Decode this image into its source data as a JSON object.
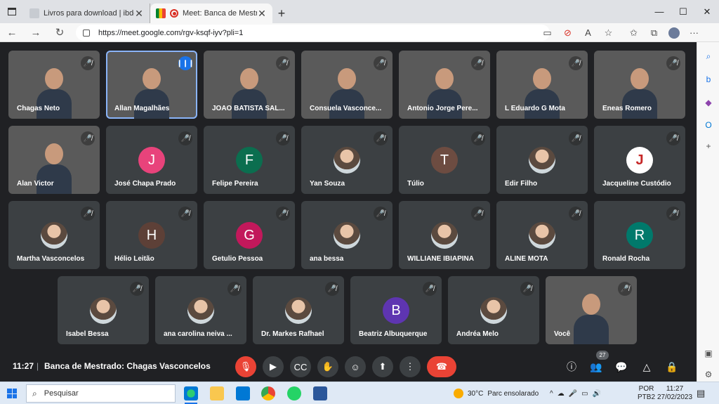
{
  "browser": {
    "tabs": [
      {
        "title": "Livros para download | ibdcult",
        "active": false
      },
      {
        "title": "Meet: Banca de Mestrado: C",
        "active": true
      }
    ],
    "url": "https://meet.google.com/rgv-ksqf-iyv?pli=1"
  },
  "meeting": {
    "time": "11:27",
    "separator": "|",
    "title": "Banca de Mestrado: Chagas Vasconcelos",
    "participant_count": "27"
  },
  "participants": [
    {
      "name": "Chagas Neto",
      "kind": "video",
      "mic": "muted"
    },
    {
      "name": "Allan Magalhães",
      "kind": "video",
      "mic": "speaking"
    },
    {
      "name": "JOAO BATISTA SAL...",
      "kind": "video",
      "mic": "muted"
    },
    {
      "name": "Consuela Vasconce...",
      "kind": "video",
      "mic": "muted"
    },
    {
      "name": "Antonio Jorge Pere...",
      "kind": "video",
      "mic": "muted"
    },
    {
      "name": "L Eduardo G Mota",
      "kind": "video",
      "mic": "muted"
    },
    {
      "name": "Eneas Romero",
      "kind": "video",
      "mic": "muted"
    },
    {
      "name": "Alan Victor",
      "kind": "video",
      "mic": "muted"
    },
    {
      "name": "José Chapa Prado",
      "kind": "letter",
      "letter": "J",
      "color": "#e8437b",
      "mic": "muted"
    },
    {
      "name": "Felipe Pereira",
      "kind": "letter",
      "letter": "F",
      "color": "#0b6e4f",
      "mic": "muted"
    },
    {
      "name": "Yan Souza",
      "kind": "photo",
      "mic": "muted"
    },
    {
      "name": "Túlio",
      "kind": "letter",
      "letter": "T",
      "color": "#6d4c41",
      "mic": "muted"
    },
    {
      "name": "Edir Filho",
      "kind": "photo",
      "mic": "muted"
    },
    {
      "name": "Jacqueline Custódio",
      "kind": "logo",
      "letter": "J",
      "mic": "muted"
    },
    {
      "name": "Martha Vasconcelos",
      "kind": "photo",
      "mic": "muted"
    },
    {
      "name": "Hélio Leitão",
      "kind": "letter",
      "letter": "H",
      "color": "#5d4037",
      "mic": "muted"
    },
    {
      "name": "Getulio Pessoa",
      "kind": "letter",
      "letter": "G",
      "color": "#c2185b",
      "mic": "muted"
    },
    {
      "name": "ana bessa",
      "kind": "photo",
      "mic": "muted"
    },
    {
      "name": "WILLIANE IBIAPINA",
      "kind": "photo",
      "mic": "muted"
    },
    {
      "name": "ALINE MOTA",
      "kind": "photo",
      "mic": "muted"
    },
    {
      "name": "Ronald Rocha",
      "kind": "letter",
      "letter": "R",
      "color": "#00796b",
      "mic": "muted"
    },
    {
      "name": "Isabel Bessa",
      "kind": "photo",
      "mic": "muted"
    },
    {
      "name": "ana carolina neiva ...",
      "kind": "photo",
      "mic": "muted"
    },
    {
      "name": "Dr. Markes Rafhael",
      "kind": "photo",
      "mic": "muted"
    },
    {
      "name": "Beatriz Albuquerque",
      "kind": "letter",
      "letter": "B",
      "color": "#5e35b1",
      "mic": "muted"
    },
    {
      "name": "Andréa Melo",
      "kind": "photo",
      "mic": "muted"
    },
    {
      "name": "Você",
      "kind": "video",
      "mic": "muted"
    }
  ],
  "taskbar": {
    "search_placeholder": "Pesquisar",
    "weather_temp": "30°C",
    "weather_desc": "Parc ensolarado",
    "lang_top": "POR",
    "lang_bottom": "PTB2",
    "time": "11:27",
    "date": "27/02/2023"
  },
  "icons": {
    "mic_off": "🎤",
    "tray": [
      "chevron-up-icon",
      "cloud-icon",
      "mic-icon",
      "battery-icon",
      "wifi-icon",
      "volume-icon"
    ]
  }
}
